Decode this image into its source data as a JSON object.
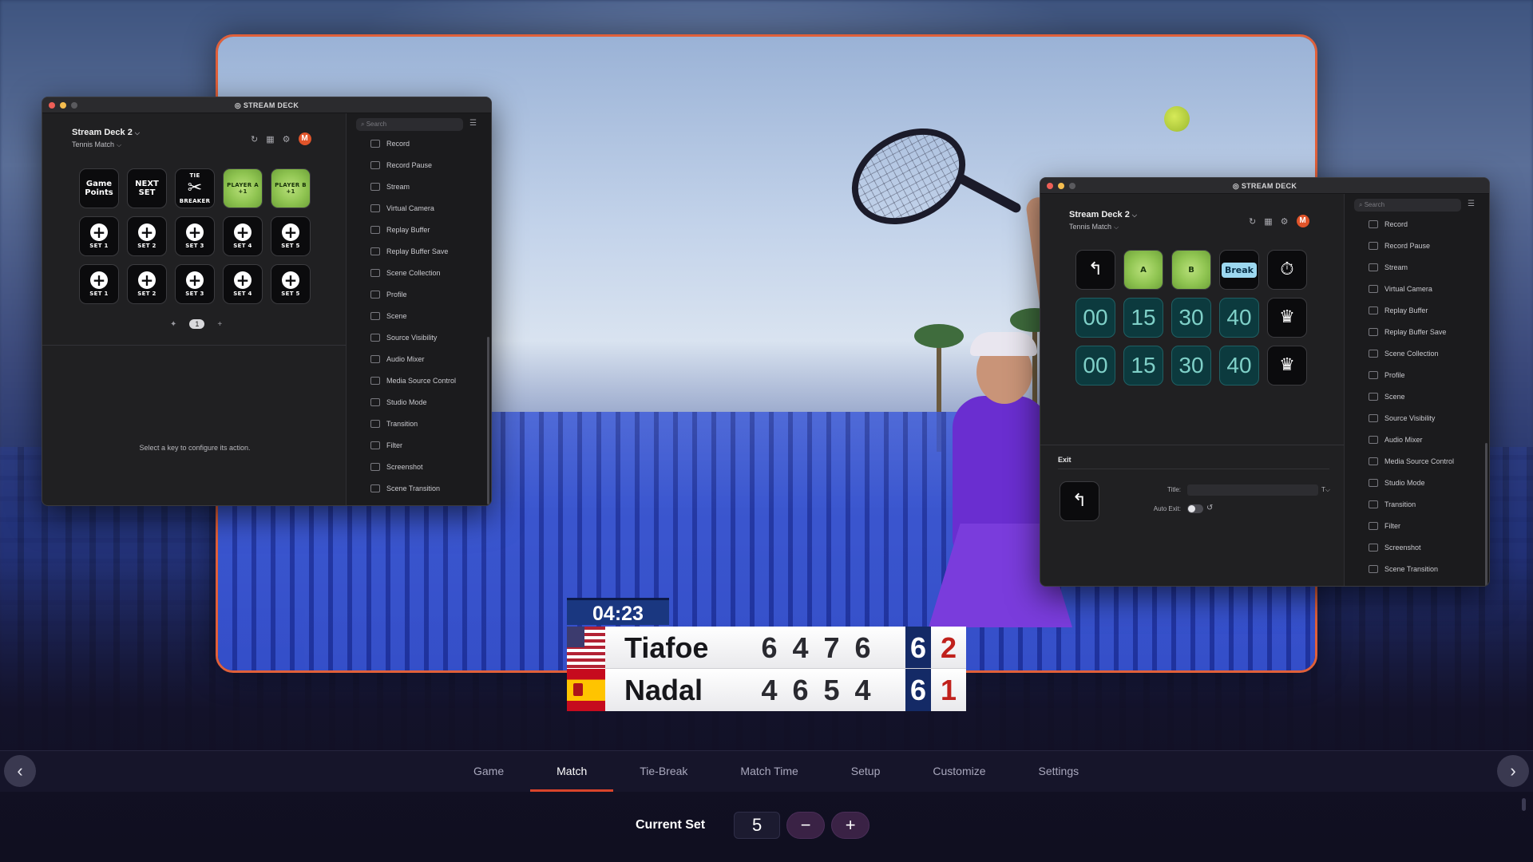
{
  "scoreboard": {
    "timer": "04:23",
    "players": [
      {
        "name": "Tiafoe",
        "country": "us-flag",
        "sets": [
          "6",
          "4",
          "7",
          "6"
        ],
        "current_set": "6",
        "game": "2"
      },
      {
        "name": "Nadal",
        "country": "es-flag",
        "sets": [
          "4",
          "6",
          "5",
          "4"
        ],
        "current_set": "6",
        "game": "1"
      }
    ]
  },
  "deck_left": {
    "title": "STREAM DECK",
    "device": "Stream Deck 2",
    "profile": "Tennis Match",
    "search_placeholder": "Search",
    "keys_row1": [
      {
        "type": "text",
        "lines": [
          "Game",
          "Points"
        ]
      },
      {
        "type": "text",
        "lines": [
          "NEXT",
          "SET"
        ]
      },
      {
        "type": "breaker",
        "top": "TIE",
        "glyph": "✂",
        "bottom": "BREAKER"
      },
      {
        "type": "ball",
        "lines": [
          "PLAYER A",
          "+1"
        ]
      },
      {
        "type": "ball",
        "lines": [
          "PLAYER B",
          "+1"
        ]
      }
    ],
    "keys_row2": [
      "SET 1",
      "SET 2",
      "SET 3",
      "SET 4",
      "SET 5"
    ],
    "keys_row3": [
      "SET 1",
      "SET 2",
      "SET 3",
      "SET 4",
      "SET 5"
    ],
    "page_number": "1",
    "hint": "Select a key to configure its action.",
    "actions": [
      "Record",
      "Record Pause",
      "Stream",
      "Virtual Camera",
      "Replay Buffer",
      "Replay Buffer Save",
      "Scene Collection",
      "Profile",
      "Scene",
      "Source Visibility",
      "Audio Mixer",
      "Media Source Control",
      "Studio Mode",
      "Transition",
      "Filter",
      "Screenshot",
      "Scene Transition"
    ]
  },
  "deck_right": {
    "title": "STREAM DECK",
    "device": "Stream Deck 2",
    "profile": "Tennis Match",
    "search_placeholder": "Search",
    "keys_row1": [
      {
        "type": "icon",
        "glyph": "↰"
      },
      {
        "type": "ball",
        "glyph": "A"
      },
      {
        "type": "ball",
        "glyph": "B"
      },
      {
        "type": "break",
        "label": "Break"
      },
      {
        "type": "icon",
        "glyph": "⏱"
      }
    ],
    "score_row_a": [
      "00",
      "15",
      "30",
      "40"
    ],
    "score_row_b": [
      "00",
      "15",
      "30",
      "40"
    ],
    "crown_glyph": "♛",
    "exit_label": "Exit",
    "title_label": "Title:",
    "auto_exit_label": "Auto Exit:",
    "actions": [
      "Record",
      "Record Pause",
      "Stream",
      "Virtual Camera",
      "Replay Buffer",
      "Replay Buffer Save",
      "Scene Collection",
      "Profile",
      "Scene",
      "Source Visibility",
      "Audio Mixer",
      "Media Source Control",
      "Studio Mode",
      "Transition",
      "Filter",
      "Screenshot",
      "Scene Transition"
    ]
  },
  "nav": {
    "prev": "‹",
    "next": "›",
    "tabs": [
      "Game",
      "Match",
      "Tie-Break",
      "Match Time",
      "Setup",
      "Customize",
      "Settings"
    ],
    "active_tab": "Match"
  },
  "current_set": {
    "label": "Current Set",
    "value": "5",
    "minus": "−",
    "plus": "+"
  },
  "colors": {
    "accent": "#d9442b",
    "frame_border": "#e0603a",
    "scoreboard_blue": "#142a66",
    "game_score_red": "#c0211c"
  }
}
